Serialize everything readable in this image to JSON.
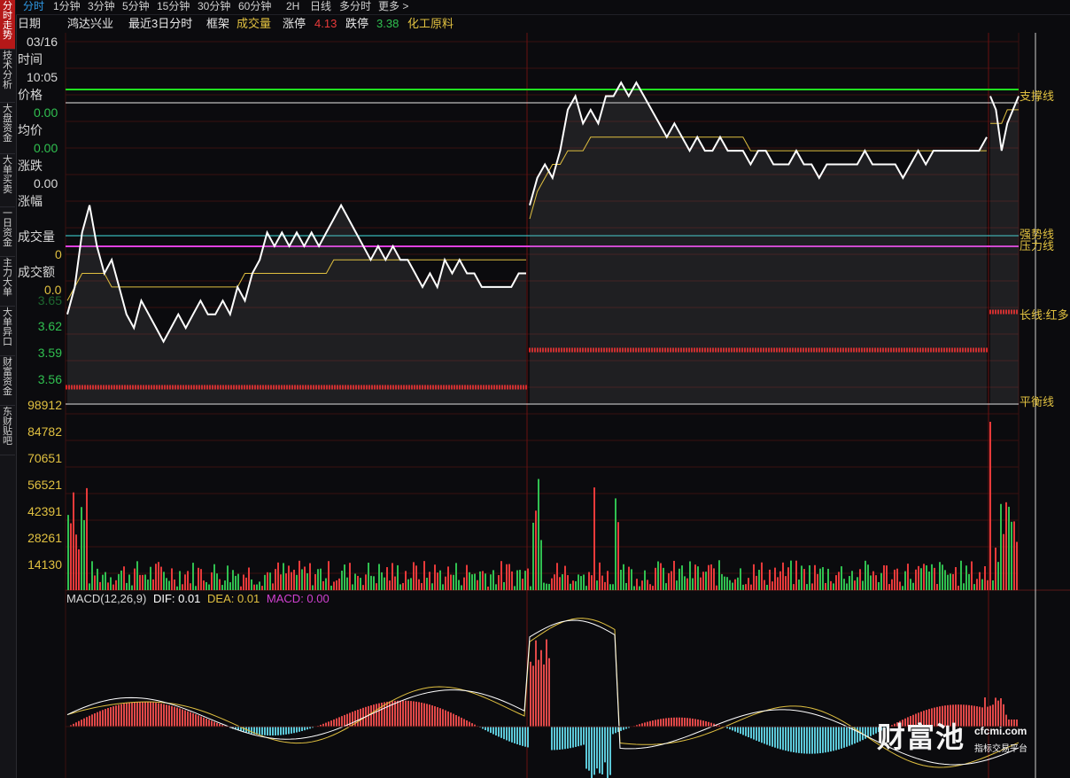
{
  "side_tabs": [
    {
      "label": "分时走势",
      "active": true
    },
    {
      "label": "技术分析",
      "active": false
    },
    {
      "label": "大盘资金",
      "active": false
    },
    {
      "label": "大单买卖",
      "active": false
    },
    {
      "label": "一日资金",
      "active": false
    },
    {
      "label": "主力大单",
      "active": false
    },
    {
      "label": "大单异口",
      "active": false
    },
    {
      "label": "财富资金",
      "active": false
    },
    {
      "label": "东财贴吧",
      "active": false
    }
  ],
  "period_tabs": [
    {
      "label": "分时",
      "active": true
    },
    {
      "label": "1分钟"
    },
    {
      "label": "3分钟"
    },
    {
      "label": "5分钟"
    },
    {
      "label": "15分钟"
    },
    {
      "label": "30分钟"
    },
    {
      "label": "60分钟"
    },
    {
      "label": "2H"
    },
    {
      "label": "日线"
    },
    {
      "label": "多分时"
    },
    {
      "label": "更多 >"
    }
  ],
  "info": {
    "date_label": "日期",
    "stock_name": "鸿达兴业",
    "range_label": "最近3日分时",
    "frame_label": "框架",
    "volume_label": "成交量",
    "limit_up_label": "涨停",
    "limit_up_value": "4.13",
    "limit_down_label": "跌停",
    "limit_down_value": "3.38",
    "sector": "化工原料"
  },
  "left_panel": {
    "date_value": "03/16",
    "time_label": "时间",
    "time_value": "10:05",
    "price_label": "价格",
    "price_value": "0.00",
    "avg_label": "均价",
    "avg_value": "0.00",
    "change_label": "涨跌",
    "change_value": "0.00",
    "pct_label": "涨幅",
    "volume_label": "成交量",
    "volume_value": "0",
    "amount_label": "成交额",
    "amount_value": "0.0"
  },
  "price_axis": [
    "3.65",
    "3.62",
    "3.59",
    "3.56"
  ],
  "volume_axis": [
    "98912",
    "84782",
    "70651",
    "56521",
    "42391",
    "28261",
    "14130"
  ],
  "right_labels": {
    "support": "支撑线",
    "strong": "强势线",
    "pressure": "压力线",
    "long": "长线:红多",
    "balance": "平衡线"
  },
  "macd": {
    "title": "MACD(12,26,9)",
    "dif": "DIF: 0.01",
    "dea": "DEA: 0.01",
    "macd": "MACD: 0.00"
  },
  "watermark": {
    "brand": "财富池",
    "url": "cfcmi.com",
    "sub": "指标交易平台"
  },
  "colors": {
    "up": "#e83a3a",
    "down": "#30c050",
    "price_line": "#ffffff",
    "avg_line": "#e0c040",
    "support_line": "#20e020",
    "strong_line": "#40e0e0",
    "pressure_line": "#e040e0",
    "macd_pos": "#e04848",
    "macd_neg": "#5cc8d8",
    "dea_line": "#e0c040",
    "dif_line": "#ffffff"
  },
  "chart_data": {
    "type": "line",
    "title": "鸿达兴业 最近3日分时",
    "price_range": [
      3.52,
      3.78
    ],
    "price_ticks": [
      3.65,
      3.62,
      3.59,
      3.56
    ],
    "limit_up": 4.13,
    "limit_down": 3.38,
    "volume_ticks": [
      98912,
      84782,
      70651,
      56521,
      42391,
      28261,
      14130
    ],
    "day1_price": [
      3.58,
      3.6,
      3.64,
      3.66,
      3.63,
      3.61,
      3.62,
      3.6,
      3.58,
      3.57,
      3.59,
      3.58,
      3.57,
      3.56,
      3.57,
      3.58,
      3.57,
      3.58,
      3.59,
      3.58,
      3.58,
      3.59,
      3.58,
      3.6,
      3.59,
      3.61,
      3.62,
      3.64,
      3.63,
      3.64,
      3.63,
      3.64,
      3.63,
      3.64,
      3.63,
      3.64,
      3.65,
      3.66,
      3.65,
      3.64,
      3.63,
      3.62,
      3.63,
      3.62,
      3.63,
      3.62,
      3.62,
      3.61,
      3.6,
      3.61,
      3.6,
      3.62,
      3.61,
      3.62,
      3.61,
      3.61,
      3.6,
      3.6,
      3.6,
      3.6,
      3.6,
      3.61,
      3.61
    ],
    "day1_avg": [
      3.59,
      3.6,
      3.61,
      3.61,
      3.61,
      3.61,
      3.6,
      3.6,
      3.6,
      3.6,
      3.6,
      3.6,
      3.6,
      3.6,
      3.6,
      3.6,
      3.6,
      3.6,
      3.6,
      3.6,
      3.6,
      3.6,
      3.6,
      3.6,
      3.61,
      3.61,
      3.61,
      3.61,
      3.61,
      3.61,
      3.61,
      3.61,
      3.61,
      3.61,
      3.61,
      3.61,
      3.62,
      3.62,
      3.62,
      3.62,
      3.62,
      3.62,
      3.62,
      3.62,
      3.62,
      3.62,
      3.62,
      3.62,
      3.62,
      3.62,
      3.62,
      3.62,
      3.62,
      3.62,
      3.62,
      3.62,
      3.62,
      3.62,
      3.62,
      3.62,
      3.62,
      3.62,
      3.62
    ],
    "day2_price": [
      3.66,
      3.68,
      3.69,
      3.68,
      3.7,
      3.73,
      3.74,
      3.72,
      3.73,
      3.72,
      3.74,
      3.74,
      3.75,
      3.74,
      3.75,
      3.74,
      3.73,
      3.72,
      3.71,
      3.72,
      3.71,
      3.7,
      3.71,
      3.7,
      3.7,
      3.71,
      3.7,
      3.7,
      3.7,
      3.69,
      3.7,
      3.7,
      3.69,
      3.69,
      3.69,
      3.7,
      3.69,
      3.69,
      3.68,
      3.69,
      3.69,
      3.69,
      3.69,
      3.69,
      3.7,
      3.69,
      3.69,
      3.69,
      3.69,
      3.68,
      3.69,
      3.7,
      3.69,
      3.7,
      3.7,
      3.7,
      3.7,
      3.7,
      3.7,
      3.7,
      3.71
    ],
    "day2_avg": [
      3.65,
      3.67,
      3.68,
      3.69,
      3.69,
      3.7,
      3.7,
      3.7,
      3.71,
      3.71,
      3.71,
      3.71,
      3.71,
      3.71,
      3.71,
      3.71,
      3.71,
      3.71,
      3.71,
      3.71,
      3.71,
      3.71,
      3.71,
      3.71,
      3.71,
      3.71,
      3.71,
      3.71,
      3.71,
      3.7,
      3.7,
      3.7,
      3.7,
      3.7,
      3.7,
      3.7,
      3.7,
      3.7,
      3.7,
      3.7,
      3.7,
      3.7,
      3.7,
      3.7,
      3.7,
      3.7,
      3.7,
      3.7,
      3.7,
      3.7,
      3.7,
      3.7,
      3.7,
      3.7,
      3.7,
      3.7,
      3.7,
      3.7,
      3.7,
      3.7,
      3.7
    ],
    "day3_price": [
      3.74,
      3.73,
      3.7,
      3.72,
      3.73,
      3.74
    ],
    "day3_avg": [
      3.72,
      3.72,
      3.72,
      3.73,
      3.73,
      3.73
    ]
  }
}
